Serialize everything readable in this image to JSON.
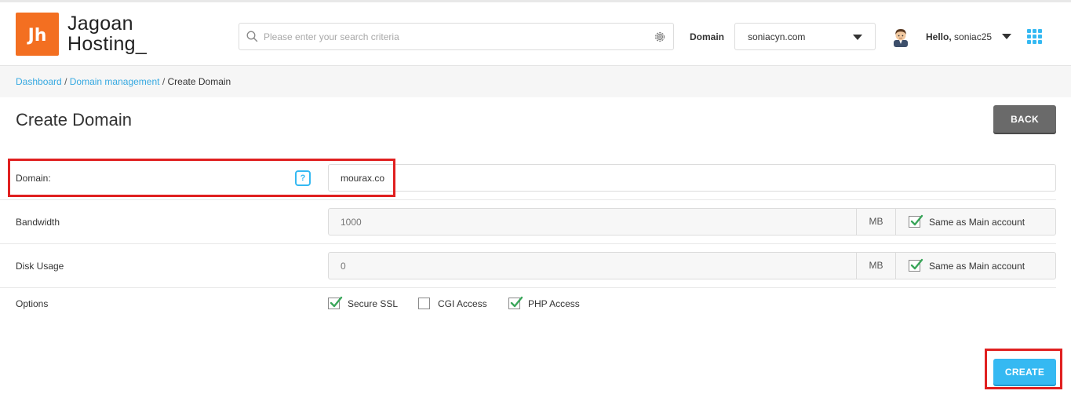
{
  "brand": {
    "name_line1": "Jagoan",
    "name_line2": "Hosting_",
    "logo_letters": "Jh",
    "accent": "#f36f21"
  },
  "header": {
    "search_placeholder": "Please enter your search criteria",
    "domain_label": "Domain",
    "domain_selected": "soniacyn.com",
    "hello_prefix": "Hello,",
    "username": "soniac25",
    "icons": [
      "search-icon",
      "gear-icon",
      "chevron-down-icon",
      "avatar",
      "apps-grid-icon"
    ]
  },
  "breadcrumb": {
    "items": [
      "Dashboard",
      "Domain management",
      "Create Domain"
    ],
    "separator": "/"
  },
  "page": {
    "title": "Create Domain",
    "back_label": "BACK",
    "create_label": "CREATE"
  },
  "form": {
    "domain": {
      "label": "Domain:",
      "help": "?",
      "value": "mourax.co"
    },
    "bandwidth": {
      "label": "Bandwidth",
      "value": "1000",
      "unit": "MB",
      "same_label": "Same as Main account",
      "same_checked": true
    },
    "disk": {
      "label": "Disk Usage",
      "value": "0",
      "unit": "MB",
      "same_label": "Same as Main account",
      "same_checked": true
    },
    "options": {
      "label": "Options",
      "items": [
        {
          "label": "Secure SSL",
          "checked": true
        },
        {
          "label": "CGI Access",
          "checked": false
        },
        {
          "label": "PHP Access",
          "checked": true
        }
      ]
    }
  },
  "colors": {
    "primary": "#35b9f2",
    "check": "#3aa65a",
    "highlight": "#e02020",
    "back_button": "#6a6a6a"
  }
}
